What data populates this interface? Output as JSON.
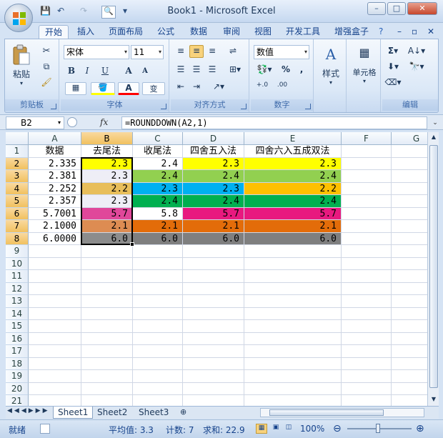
{
  "app": {
    "title": "Book1 - Microsoft Excel",
    "window_buttons": [
      "–",
      "□",
      "✕"
    ]
  },
  "qat": {
    "save": "💾",
    "undo": "↶",
    "redo": "↷",
    "customize": "▾"
  },
  "tabs": [
    {
      "label": "开始",
      "active": true
    },
    {
      "label": "插入"
    },
    {
      "label": "页面布局"
    },
    {
      "label": "公式"
    },
    {
      "label": "数据"
    },
    {
      "label": "审阅"
    },
    {
      "label": "视图"
    },
    {
      "label": "开发工具"
    },
    {
      "label": "增强盒子"
    }
  ],
  "ribbon": {
    "clipboard": {
      "label": "剪贴板",
      "paste": "粘贴"
    },
    "font": {
      "label": "字体",
      "name": "宋体",
      "size": "11",
      "bold": "B",
      "italic": "I",
      "underline": "U",
      "grow": "A",
      "shrink": "A",
      "wen": "变"
    },
    "alignment": {
      "label": "对齐方式"
    },
    "number": {
      "label": "数字",
      "format": "数值",
      "percent": "%",
      "comma": ","
    },
    "styles": {
      "label": "样式"
    },
    "cells": {
      "label": "单元格"
    },
    "editing": {
      "label": "编辑",
      "sum": "Σ"
    }
  },
  "formula_bar": {
    "name_box": "B2",
    "fx": "fx",
    "formula": "=ROUNDDOWN(A2,1)"
  },
  "sheet": {
    "columns": [
      "A",
      "B",
      "C",
      "D",
      "E",
      "F",
      "G"
    ],
    "selected_column": "B",
    "rows": [
      "1",
      "2",
      "3",
      "4",
      "5",
      "6",
      "7",
      "8",
      "9",
      "10",
      "11",
      "12",
      "13",
      "14",
      "15",
      "16",
      "17",
      "18",
      "19",
      "20",
      "21"
    ],
    "header_row": [
      "数据",
      "去尾法",
      "收尾法",
      "四舍五入法",
      "四舍六入五成双法"
    ],
    "data": [
      [
        "2.335",
        "2.3",
        "2.4",
        "2.3",
        "2.3"
      ],
      [
        "2.381",
        "2.3",
        "2.4",
        "2.4",
        "2.4"
      ],
      [
        "2.252",
        "2.2",
        "2.3",
        "2.3",
        "2.2"
      ],
      [
        "2.357",
        "2.3",
        "2.4",
        "2.4",
        "2.4"
      ],
      [
        "5.7001",
        "5.7",
        "5.8",
        "5.7",
        "5.7"
      ],
      [
        "2.1000",
        "2.1",
        "2.1",
        "2.1",
        "2.1"
      ],
      [
        "6.0000",
        "6.0",
        "6.0",
        "6.0",
        "6.0"
      ]
    ],
    "fills": [
      [
        "#ffff00",
        "#ffffff",
        "#ffff00",
        "#ffff00"
      ],
      [
        "#eeeef6",
        "#92d050",
        "#92d050",
        "#92d050"
      ],
      [
        "#e8be5a",
        "#00b0f0",
        "#00b0f0",
        "#ffc000"
      ],
      [
        "#eeeef6",
        "#00b050",
        "#00b050",
        "#00b050"
      ],
      [
        "#e0479a",
        "#ffffff",
        "#e8197f",
        "#e8197f"
      ],
      [
        "#dd8c52",
        "#e36c09",
        "#e36c09",
        "#e36c09"
      ],
      [
        "#8c8c8c",
        "#7f7f7f",
        "#7f7f7f",
        "#7f7f7f"
      ]
    ]
  },
  "sheet_tabs": [
    "Sheet1",
    "Sheet2",
    "Sheet3"
  ],
  "status": {
    "ready": "就绪",
    "average": "平均值: 3.3",
    "count": "计数: 7",
    "sum": "求和: 22.9",
    "zoom": "100%"
  }
}
